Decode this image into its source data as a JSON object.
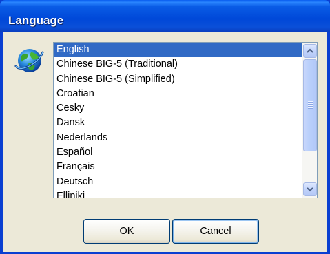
{
  "window": {
    "title": "Language"
  },
  "language_list": {
    "items": [
      {
        "label": "English",
        "selected": true
      },
      {
        "label": "Chinese BIG-5 (Traditional)",
        "selected": false
      },
      {
        "label": "Chinese BIG-5 (Simplified)",
        "selected": false
      },
      {
        "label": "Croatian",
        "selected": false
      },
      {
        "label": "Cesky",
        "selected": false
      },
      {
        "label": "Dansk",
        "selected": false
      },
      {
        "label": "Nederlands",
        "selected": false
      },
      {
        "label": "Español",
        "selected": false
      },
      {
        "label": "Français",
        "selected": false
      },
      {
        "label": "Deutsch",
        "selected": false
      },
      {
        "label": "Elliniki",
        "selected": false
      }
    ]
  },
  "buttons": {
    "ok_label": "OK",
    "cancel_label": "Cancel"
  },
  "icons": {
    "globe": "globe-icon",
    "scroll_up": "scroll-up-arrow-icon",
    "scroll_down": "scroll-down-arrow-icon"
  },
  "colors": {
    "titlebar": "#0a5ce6",
    "selection": "#316ac5",
    "dialog_background": "#ece9d8"
  }
}
